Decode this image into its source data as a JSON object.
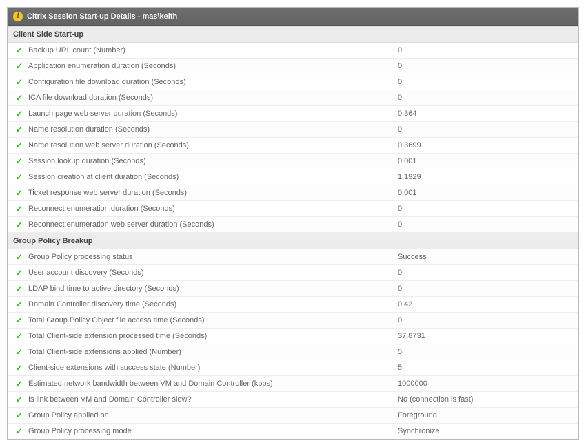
{
  "header": {
    "title": "Citrix Session Start-up Details - mas\\keith"
  },
  "sections": [
    {
      "title": "Client Side Start-up",
      "rows": [
        {
          "label": "Backup URL count (Number)",
          "value": "0"
        },
        {
          "label": "Application enumeration duration (Seconds)",
          "value": "0"
        },
        {
          "label": "Configuration file download duration (Seconds)",
          "value": "0"
        },
        {
          "label": "ICA file download duration (Seconds)",
          "value": "0"
        },
        {
          "label": "Launch page web server duration (Seconds)",
          "value": "0.364"
        },
        {
          "label": "Name resolution duration (Seconds)",
          "value": "0"
        },
        {
          "label": "Name resolution web server duration (Seconds)",
          "value": "0.3699"
        },
        {
          "label": "Session lookup duration (Seconds)",
          "value": "0.001"
        },
        {
          "label": "Session creation at client duration (Seconds)",
          "value": "1.1929"
        },
        {
          "label": "Ticket response web server duration (Seconds)",
          "value": "0.001"
        },
        {
          "label": "Reconnect enumeration duration (Seconds)",
          "value": "0"
        },
        {
          "label": "Reconnect enumeration web server duration (Seconds)",
          "value": "0"
        }
      ]
    },
    {
      "title": "Group Policy Breakup",
      "rows": [
        {
          "label": "Group Policy processing status",
          "value": "Success"
        },
        {
          "label": "User account discovery (Seconds)",
          "value": "0"
        },
        {
          "label": "LDAP bind time to active directory (Seconds)",
          "value": "0"
        },
        {
          "label": "Domain Controller discovery time (Seconds)",
          "value": "0.42"
        },
        {
          "label": "Total Group Policy Object file access time (Seconds)",
          "value": "0"
        },
        {
          "label": "Total Client-side extension processed time (Seconds)",
          "value": "37.8731"
        },
        {
          "label": "Total Client-side extensions applied (Number)",
          "value": "5"
        },
        {
          "label": "Client-side extensions with success state (Number)",
          "value": "5"
        },
        {
          "label": "Estimated network bandwidth between VM and Domain Controller (kbps)",
          "value": "1000000"
        },
        {
          "label": "Is link between VM and Domain Controller slow?",
          "value": "No (connection is fast)"
        },
        {
          "label": "Group Policy applied on",
          "value": "Foreground"
        },
        {
          "label": "Group Policy processing mode",
          "value": "Synchronize"
        }
      ]
    }
  ]
}
